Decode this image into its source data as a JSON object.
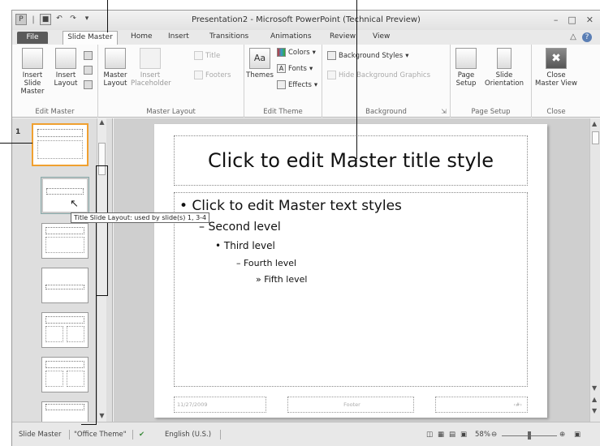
{
  "window": {
    "title": "Presentation2 - Microsoft PowerPoint (Technical Preview)",
    "controls": [
      "–",
      "□",
      "✕"
    ]
  },
  "qat": {
    "save": "■",
    "undo": "↶",
    "redo": "↷",
    "customize": "▾"
  },
  "tabs": {
    "file": "File",
    "slide_master": "Slide Master",
    "home": "Home",
    "insert": "Insert",
    "transitions": "Transitions",
    "animations": "Animations",
    "review": "Review",
    "view": "View"
  },
  "ribbon": {
    "edit_master": {
      "label": "Edit Master",
      "insert_slide_master": "Insert Slide Master",
      "insert_layout": "Insert Layout"
    },
    "master_layout": {
      "label": "Master Layout",
      "master_layout": "Master Layout",
      "insert_placeholder": "Insert Placeholder",
      "title": "Title",
      "footers": "Footers"
    },
    "edit_theme": {
      "label": "Edit Theme",
      "themes": "Themes",
      "colors": "Colors",
      "fonts": "Fonts",
      "effects": "Effects"
    },
    "background": {
      "label": "Background",
      "background_styles": "Background Styles",
      "hide_background_graphics": "Hide Background Graphics"
    },
    "page_setup": {
      "label": "Page Setup",
      "page_setup": "Page Setup",
      "slide_orientation": "Slide Orientation"
    },
    "close": {
      "label": "Close",
      "close_master_view": "Close Master View"
    }
  },
  "thumbnails": {
    "master_number": "1",
    "count": 7
  },
  "tooltip": "Title Slide Layout: used by slide(s) 1, 3-4",
  "slide": {
    "title": "Click to edit Master title style",
    "level1": "•  Click to edit Master text styles",
    "level2": "– Second level",
    "level3": "•  Third level",
    "level4": "– Fourth level",
    "level5": "»  Fifth level",
    "date": "11/27/2009",
    "footer": "Footer",
    "number": "‹#›"
  },
  "statusbar": {
    "view": "Slide Master",
    "theme": "\"Office Theme\"",
    "language": "English (U.S.)",
    "zoom": "58%",
    "zoom_level": 0.5
  }
}
